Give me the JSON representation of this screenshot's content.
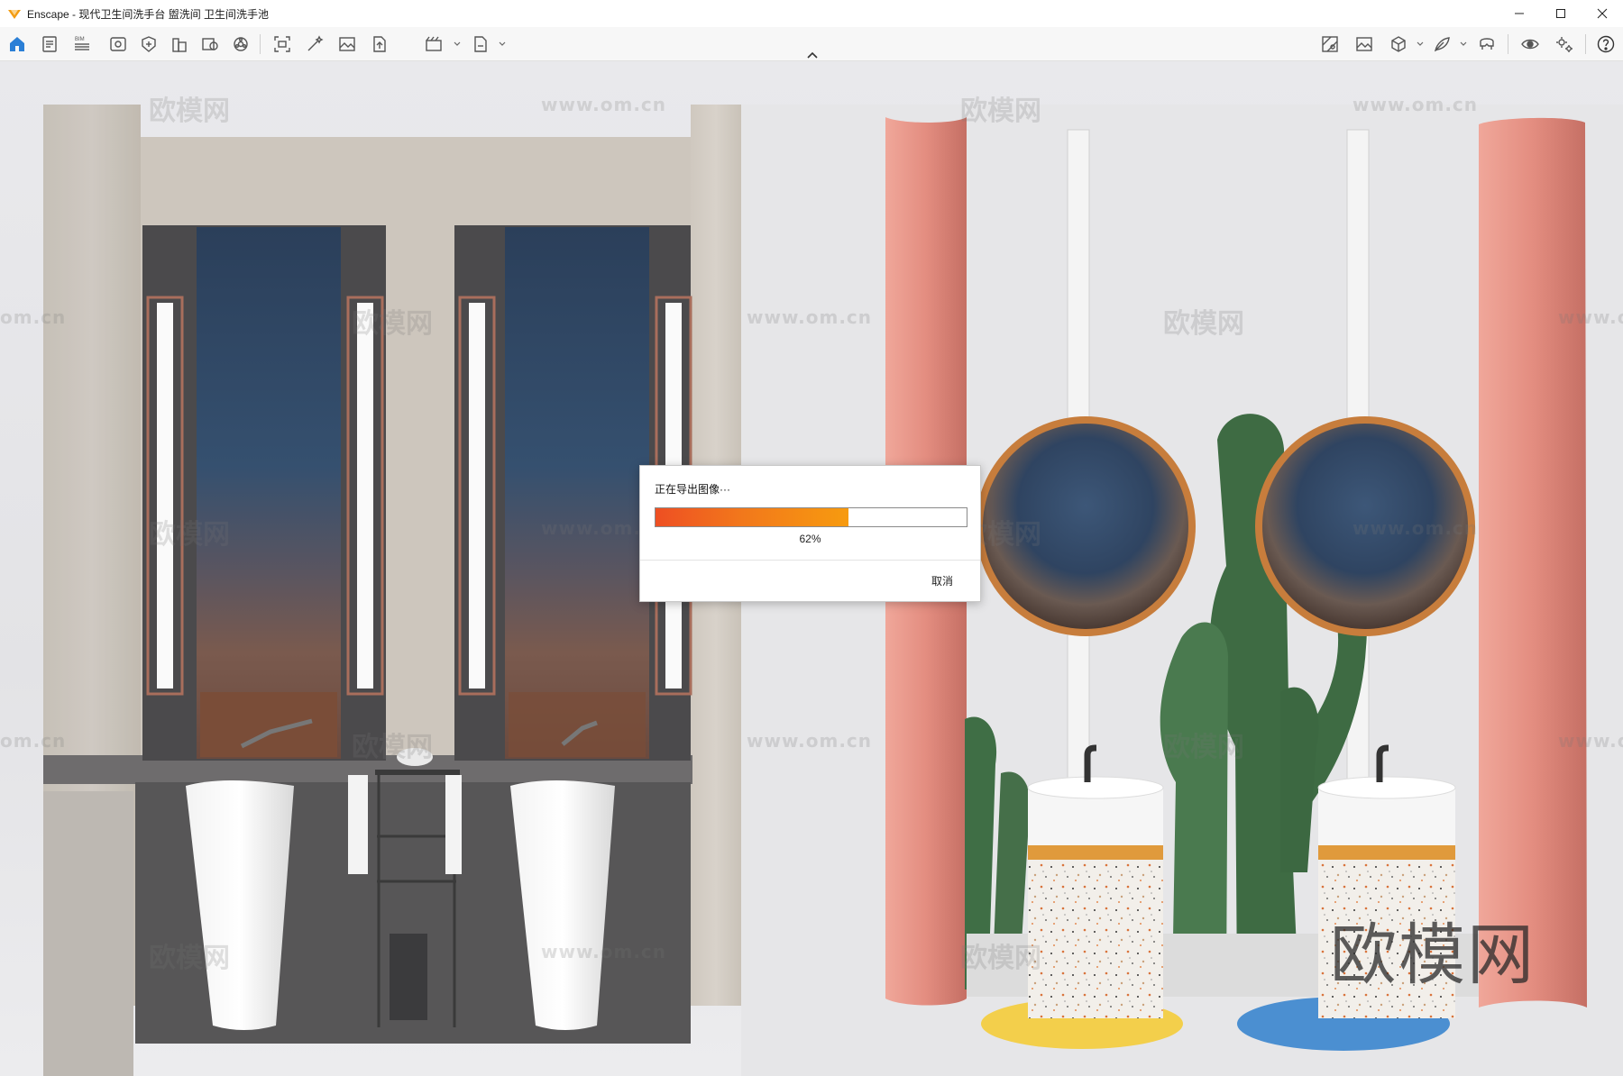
{
  "window": {
    "app_name": "Enscape",
    "title": "Enscape - 现代卫生间洗手台 盥洗间 卫生间洗手池",
    "controls": [
      "minimize",
      "maximize",
      "close"
    ]
  },
  "toolbar": {
    "left_icons": [
      "home-icon",
      "project-info-icon",
      "bim-icon",
      "view-icon",
      "asset-library-icon",
      "building-icon",
      "material-info-icon",
      "atmosphere-icon",
      "screenshot-icon",
      "magic-wand-icon",
      "image-icon",
      "upload-icon",
      "batch-render-icon",
      "export-icon"
    ],
    "bim_label": "BIM",
    "right_icons": [
      "map-icon",
      "gallery-icon",
      "cube-icon",
      "feather-icon",
      "vr-headset-icon",
      "eye-icon",
      "settings-icon",
      "help-icon"
    ]
  },
  "watermarks": {
    "logo_text": "欧模网",
    "url_text": "www.om.cn",
    "edge_text": "om.cn",
    "big_text": "欧模网"
  },
  "export_dialog": {
    "title": "正在导出图像···",
    "progress_fraction": 0.62,
    "progress_text": "62%",
    "cancel_label": "取消"
  },
  "colors": {
    "accent_orange": "#f08a1c",
    "progress_start": "#ee4f23",
    "progress_end": "#f79b0f",
    "icon_blue": "#2b7fd6"
  }
}
